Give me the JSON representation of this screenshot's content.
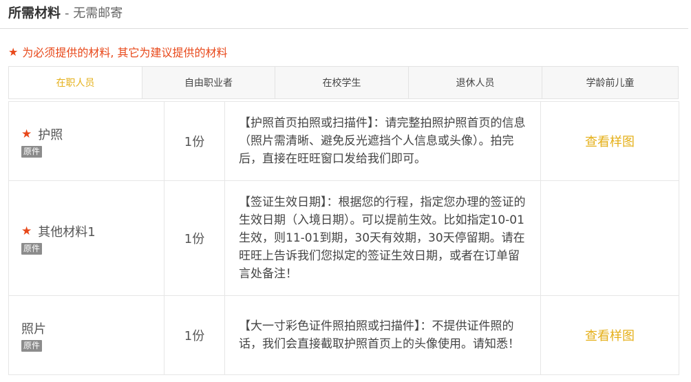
{
  "header": {
    "title": "所需材料",
    "subtitle": "- 无需邮寄"
  },
  "notice": {
    "star": "★",
    "text": "为必须提供的材料, 其它为建议提供的材料"
  },
  "tabs": [
    {
      "label": "在职人员",
      "active": true
    },
    {
      "label": "自由职业者",
      "active": false
    },
    {
      "label": "在校学生",
      "active": false
    },
    {
      "label": "退休人员",
      "active": false
    },
    {
      "label": "学龄前儿童",
      "active": false
    }
  ],
  "rows": [
    {
      "required": true,
      "star": "★",
      "name": "护照",
      "badge": "原件",
      "quantity": "1份",
      "description": "【护照首页拍照或扫描件】：请完整拍照护照首页的信息（照片需清晰、避免反光遮挡个人信息或头像）。拍完后，直接在旺旺窗口发给我们即可。",
      "sample_link": "查看样图"
    },
    {
      "required": true,
      "star": "★",
      "name": "其他材料1",
      "badge": "原件",
      "quantity": "1份",
      "description": "【签证生效日期】：根据您的行程，指定您办理的签证的生效日期（入境日期）。可以提前生效。比如指定10-01生效，则11-01到期，30天有效期，30天停留期。请在旺旺上告诉我们您拟定的签证生效日期，或者在订单留言处备注！",
      "sample_link": ""
    },
    {
      "required": false,
      "star": "",
      "name": "照片",
      "badge": "原件",
      "quantity": "1份",
      "description": "【大一寸彩色证件照拍照或扫描件】：不提供证件照的话，我们会直接截取护照首页上的头像使用。请知悉！",
      "sample_link": "查看样图"
    }
  ],
  "colors": {
    "accent": "#e5b01a",
    "required": "#e8481a",
    "badge_bg": "#8c8c8c"
  }
}
